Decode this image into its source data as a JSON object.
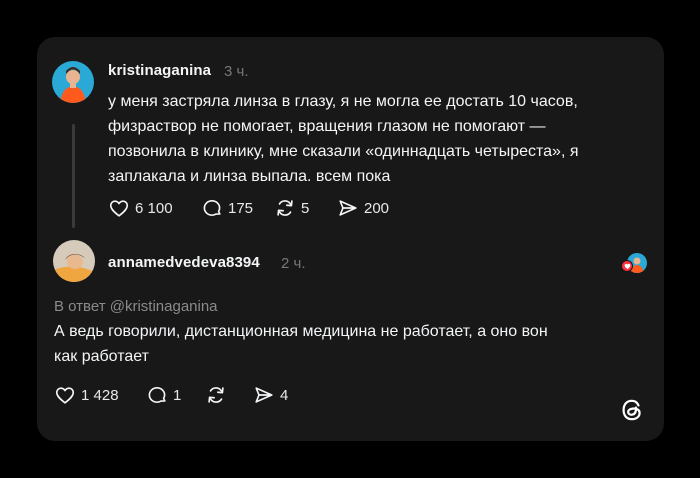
{
  "post": {
    "username": "kristinaganina",
    "time": "3 ч.",
    "text": "у меня застряла линза в глазу, я не могла ее достать 10 часов,\nфизраствор не помогает, вращения глазом не помогают —\nпозвонила в клинику, мне сказали «одиннадцать четыреста», я\nзаплакала и линза выпала. всем пока",
    "likes": "6 100",
    "replies": "175",
    "reposts": "5",
    "shares": "200"
  },
  "reply": {
    "username": "annamedvedeva8394",
    "time": "2 ч.",
    "reply_to": "В ответ @kristinaganina",
    "text": "А ведь говорили, дистанционная медицина не работает, а оно вон\nкак работает",
    "likes": "1 428",
    "replies": "1",
    "reposts": "",
    "shares": "4"
  },
  "colors": {
    "background": "#000000",
    "card": "#181818",
    "text": "#f3f5f7",
    "muted": "#777777",
    "like_red": "#ff3040"
  },
  "icons": [
    "heart-icon",
    "comment-icon",
    "repost-icon",
    "share-icon",
    "threads-logo-icon"
  ]
}
